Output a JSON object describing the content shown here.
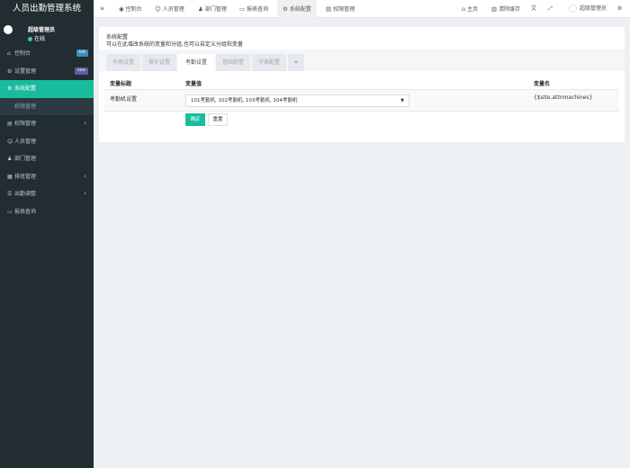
{
  "app": {
    "title": "人员出勤管理系统"
  },
  "user": {
    "name": "超级管理员",
    "status": "在线"
  },
  "sidebar": {
    "items": [
      {
        "label": "控制台",
        "icon": "⌂",
        "badge": "hot"
      },
      {
        "label": "设置管理",
        "icon": "⚙",
        "badge": "new"
      },
      {
        "label": "系统配置",
        "icon": "⚙"
      },
      {
        "label": "权限管理",
        "icon": ""
      },
      {
        "label": "权限管理",
        "icon": "▤"
      },
      {
        "label": "人员管理",
        "icon": "☺"
      },
      {
        "label": "部门管理",
        "icon": "♟"
      },
      {
        "label": "排班管理",
        "icon": "▦"
      },
      {
        "label": "出勤调整",
        "icon": "☰"
      },
      {
        "label": "报表查询",
        "icon": "▭"
      }
    ]
  },
  "topnav": {
    "menu_icon": "≡",
    "tabs": [
      {
        "label": "控制台",
        "icon": "◉"
      },
      {
        "label": "人员管理",
        "icon": "☺"
      },
      {
        "label": "部门管理",
        "icon": "♟"
      },
      {
        "label": "报表查询",
        "icon": "▭"
      },
      {
        "label": "系统配置",
        "icon": "⚙"
      },
      {
        "label": "权限管理",
        "icon": "▤"
      }
    ],
    "home": "主页",
    "home_icon": "⌂",
    "clear_cache": "清除缓存",
    "clear_icon": "▥",
    "translate_icon": "文",
    "fullscreen_icon": "⤢",
    "admin": "超级管理员",
    "settings_icon": "⚙"
  },
  "panel": {
    "title": "系统配置",
    "description": "可以在此增改系统的变量和分组,也可以自定义分组和变量",
    "tabs": [
      "年假设置",
      "餐补设置",
      "考勤设置",
      "基础配置",
      "字典配置",
      "+"
    ],
    "active_tab": 2,
    "headers": {
      "title": "变量标题",
      "value": "变量值",
      "name": "变量名"
    },
    "row": {
      "title": "考勤机设置",
      "value": "101考勤机, 102考勤机, 103考勤机, 104考勤机",
      "name": "{$site.attnmachines}"
    },
    "ok_button": "确定",
    "reset_button": "重置"
  }
}
